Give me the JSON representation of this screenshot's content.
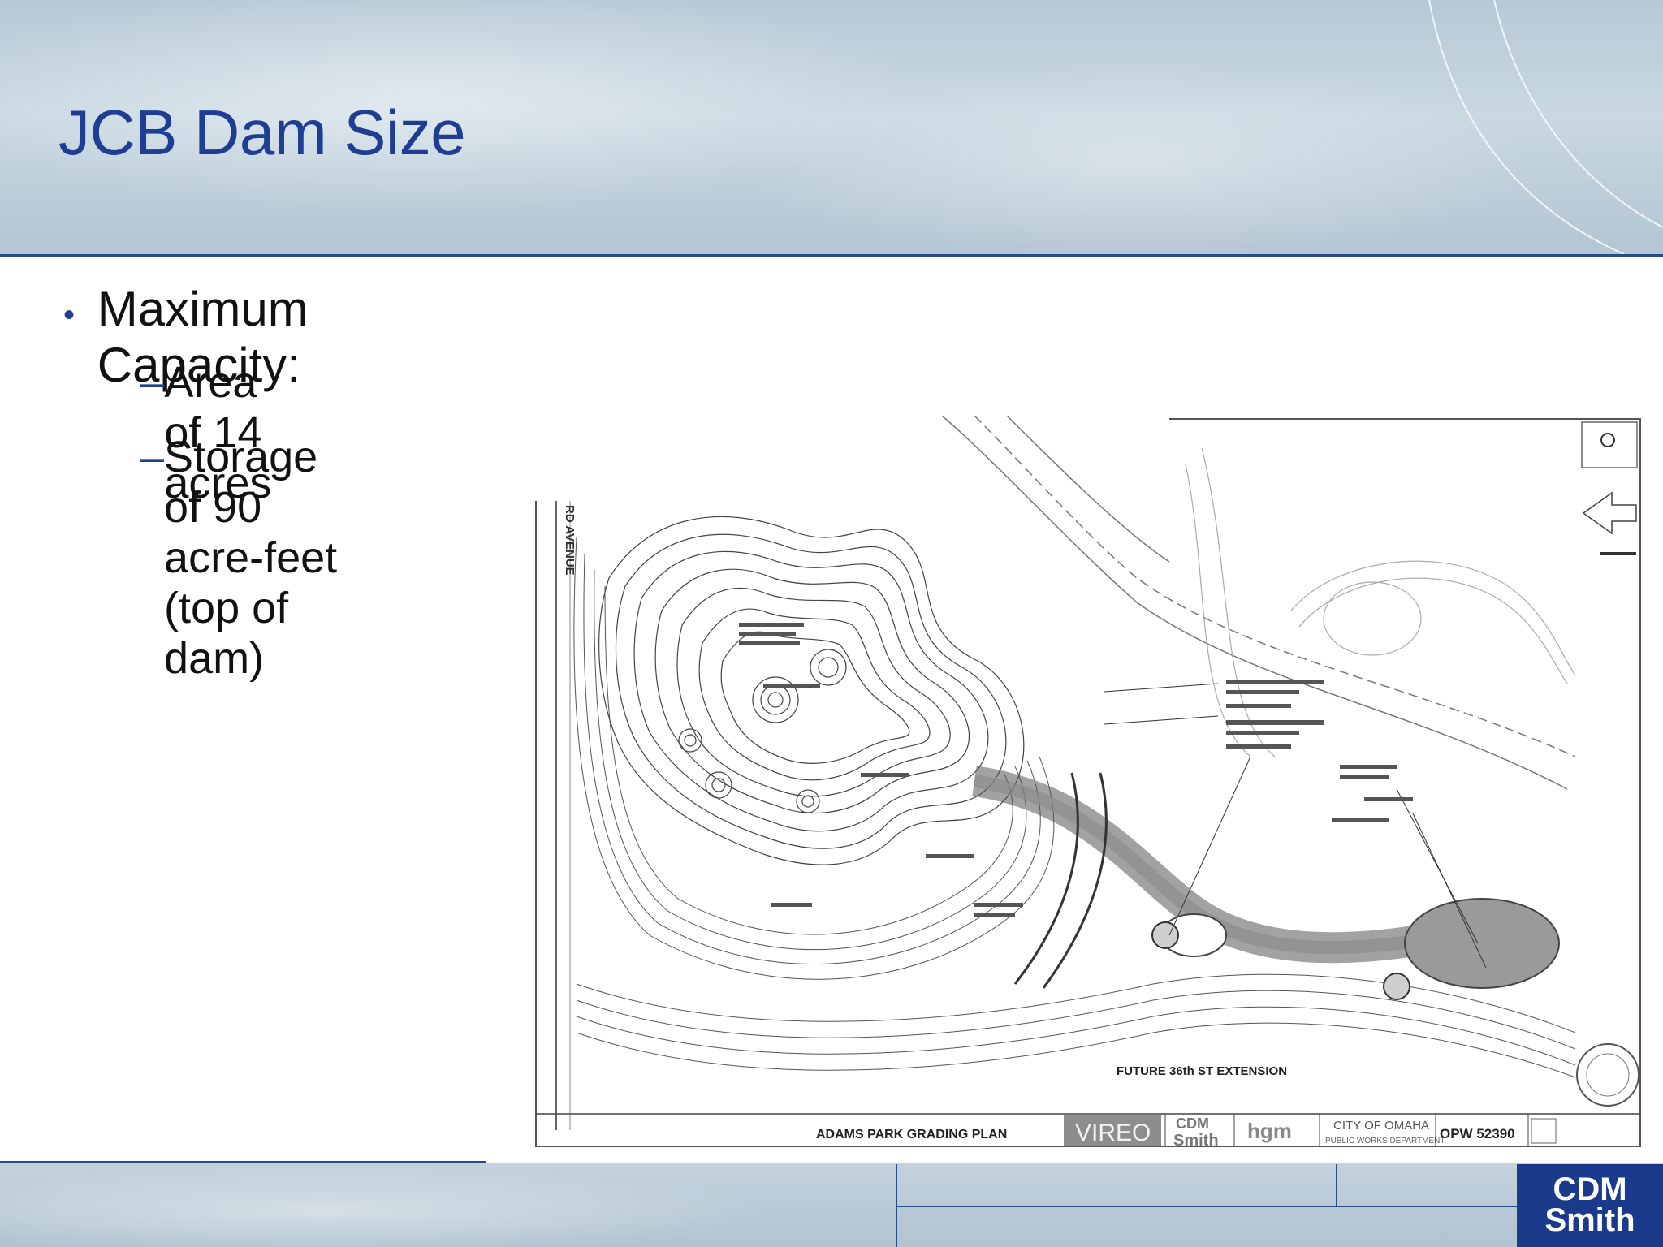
{
  "slide": {
    "title": "JCB Dam Size",
    "bullets": [
      {
        "text": "Maximum Capacity:"
      },
      {
        "text": "Area of 14 acres"
      },
      {
        "text": "Storage of 90 acre-feet (top of dam)"
      }
    ]
  },
  "plan": {
    "street_label_left": "RD AVENUE",
    "extension_label": "FUTURE 36th ST EXTENSION",
    "title_block": {
      "plan_name": "ADAMS PARK GRADING PLAN",
      "firm1": "VIREO",
      "firm2_line1": "CDM",
      "firm2_line2": "Smith",
      "firm3": "hgm",
      "city_line1": "CITY OF OMAHA",
      "city_line2": "PUBLIC WORKS DEPARTMENT",
      "project_no": "OPW 52390"
    }
  },
  "footer": {
    "logo_line1": "CDM",
    "logo_line2": "Smith"
  },
  "colors": {
    "title_blue": "#1f3e93",
    "rule_blue": "#2a4a8c"
  }
}
